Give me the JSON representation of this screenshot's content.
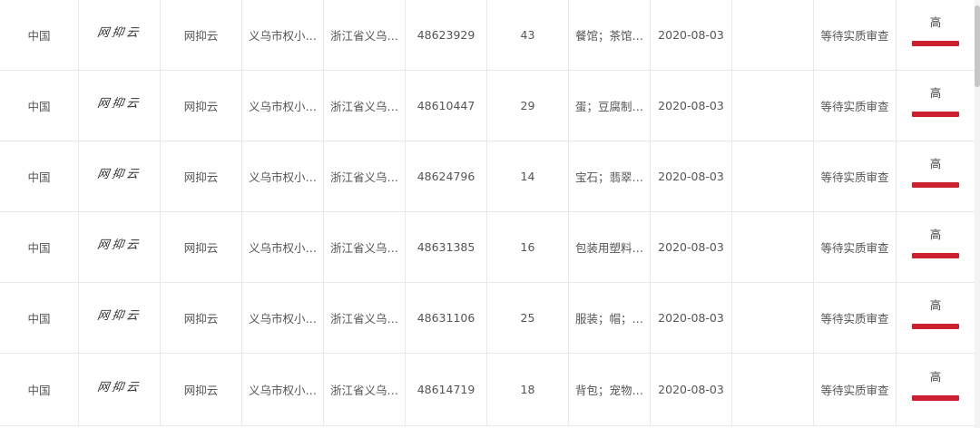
{
  "colors": {
    "level_bar": "#cc1f2f"
  },
  "rows": [
    {
      "country": "中国",
      "logo": "网抑云",
      "name": "网抑云",
      "applicant": "义乌市权小…",
      "address": "浙江省义乌…",
      "reg_no": "48623929",
      "class": "43",
      "goods": "餐馆；茶馆…",
      "date": "2020-08-03",
      "agent": "",
      "status": "等待实质审查",
      "level": "高"
    },
    {
      "country": "中国",
      "logo": "网抑云",
      "name": "网抑云",
      "applicant": "义乌市权小…",
      "address": "浙江省义乌…",
      "reg_no": "48610447",
      "class": "29",
      "goods": "蛋；豆腐制…",
      "date": "2020-08-03",
      "agent": "",
      "status": "等待实质审查",
      "level": "高"
    },
    {
      "country": "中国",
      "logo": "网抑云",
      "name": "网抑云",
      "applicant": "义乌市权小…",
      "address": "浙江省义乌…",
      "reg_no": "48624796",
      "class": "14",
      "goods": "宝石；翡翠…",
      "date": "2020-08-03",
      "agent": "",
      "status": "等待实质审查",
      "level": "高"
    },
    {
      "country": "中国",
      "logo": "网抑云",
      "name": "网抑云",
      "applicant": "义乌市权小…",
      "address": "浙江省义乌…",
      "reg_no": "48631385",
      "class": "16",
      "goods": "包装用塑料…",
      "date": "2020-08-03",
      "agent": "",
      "status": "等待实质审查",
      "level": "高"
    },
    {
      "country": "中国",
      "logo": "网抑云",
      "name": "网抑云",
      "applicant": "义乌市权小…",
      "address": "浙江省义乌…",
      "reg_no": "48631106",
      "class": "25",
      "goods": "服装；帽；…",
      "date": "2020-08-03",
      "agent": "",
      "status": "等待实质审查",
      "level": "高"
    },
    {
      "country": "中国",
      "logo": "网抑云",
      "name": "网抑云",
      "applicant": "义乌市权小…",
      "address": "浙江省义乌…",
      "reg_no": "48614719",
      "class": "18",
      "goods": "背包；宠物…",
      "date": "2020-08-03",
      "agent": "",
      "status": "等待实质审查",
      "level": "高"
    }
  ]
}
